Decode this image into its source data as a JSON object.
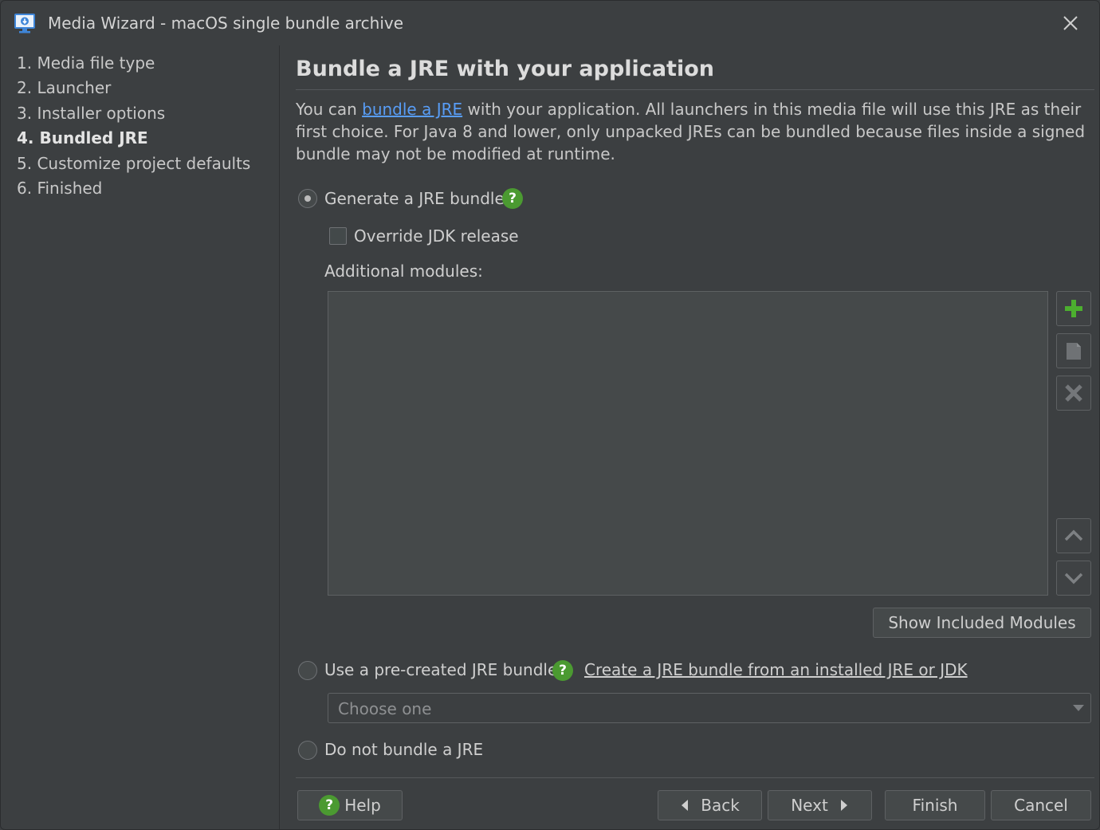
{
  "window": {
    "title": "Media Wizard - macOS single bundle archive"
  },
  "sidebar": {
    "steps": [
      {
        "label": "1. Media file type",
        "active": false
      },
      {
        "label": "2. Launcher",
        "active": false
      },
      {
        "label": "3. Installer options",
        "active": false
      },
      {
        "label": "4. Bundled JRE",
        "active": true
      },
      {
        "label": "5. Customize project defaults",
        "active": false
      },
      {
        "label": "6. Finished",
        "active": false
      }
    ]
  },
  "main": {
    "heading": "Bundle a JRE with your application",
    "description": {
      "prefix": "You can ",
      "link": "bundle a JRE",
      "suffix": " with your application. All launchers in this media file will use this JRE as their first choice. For Java 8 and lower, only unpacked JREs can be bundled because files inside a signed bundle may not be modified at runtime."
    },
    "option_generate": {
      "label": "Generate a JRE bundle",
      "selected": true
    },
    "override_jdk": {
      "label": "Override JDK release",
      "checked": false
    },
    "additional_modules_label": "Additional modules:",
    "additional_modules": [],
    "list_buttons": [
      "add-icon",
      "edit-icon",
      "remove-icon",
      "move-up-icon",
      "move-down-icon"
    ],
    "show_modules_button": "Show Included Modules",
    "option_precreated": {
      "label": "Use a pre-created JRE bundle",
      "selected": false
    },
    "create_bundle_link": "Create a JRE bundle from an installed JRE or JDK",
    "bundle_select": {
      "placeholder": "Choose one"
    },
    "option_none": {
      "label": "Do not bundle a JRE",
      "selected": false
    }
  },
  "footer": {
    "help": "Help",
    "back": "Back",
    "next": "Next",
    "finish": "Finish",
    "cancel": "Cancel"
  },
  "colors": {
    "background": "#3c3f41",
    "link": "#589df6",
    "help_green": "#4b9a31",
    "add_green": "#4caf2f"
  }
}
